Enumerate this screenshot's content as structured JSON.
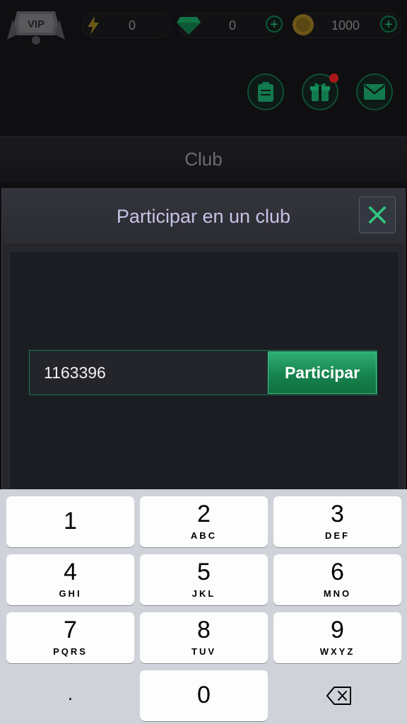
{
  "topbar": {
    "vip_label": "VIP",
    "energy_value": "0",
    "gems_value": "0",
    "coins_value": "1000",
    "plus_symbol": "+"
  },
  "club_header": {
    "title": "Club"
  },
  "dialog": {
    "title": "Participar en un club",
    "input_value": "1163396",
    "join_label": "Participar"
  },
  "keypad": {
    "keys": [
      {
        "num": "1",
        "letters": ""
      },
      {
        "num": "2",
        "letters": "ABC"
      },
      {
        "num": "3",
        "letters": "DEF"
      },
      {
        "num": "4",
        "letters": "GHI"
      },
      {
        "num": "5",
        "letters": "JKL"
      },
      {
        "num": "6",
        "letters": "MNO"
      },
      {
        "num": "7",
        "letters": "PQRS"
      },
      {
        "num": "8",
        "letters": "TUV"
      },
      {
        "num": "9",
        "letters": "WXYZ"
      }
    ],
    "dot": ".",
    "zero": "0"
  },
  "colors": {
    "accent_green": "#17844f",
    "dialog_title": "#c7c3e6",
    "notification_red": "#a91818"
  }
}
